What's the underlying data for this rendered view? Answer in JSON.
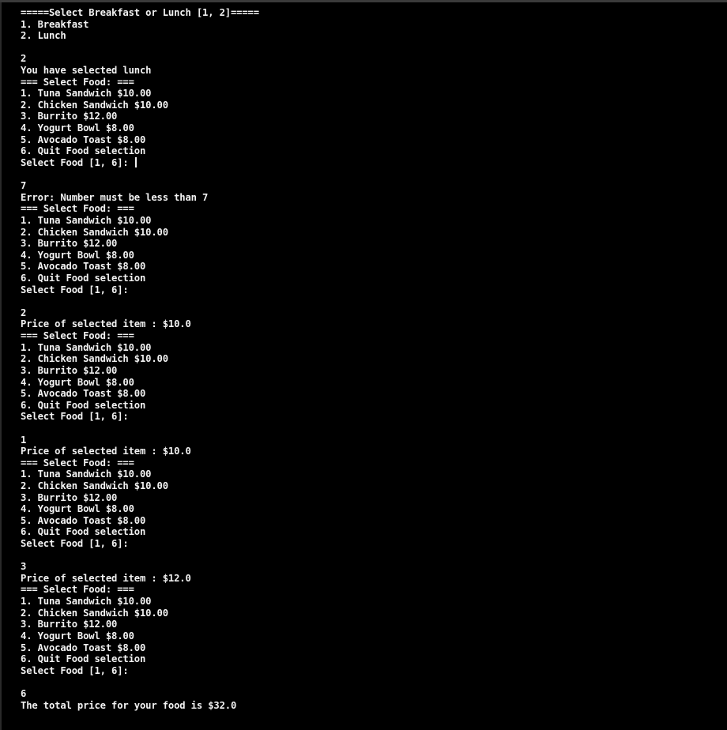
{
  "window": {
    "type": "console",
    "colors": {
      "background": "#000000",
      "text": "#f2f2f2"
    }
  },
  "console": {
    "lines": [
      "=====Select Breakfast or Lunch [1, 2]=====",
      "1. Breakfast",
      "2. Lunch",
      "",
      "2",
      "You have selected lunch",
      "=== Select Food: ===",
      "1. Tuna Sandwich $10.00",
      "2. Chicken Sandwich $10.00",
      "3. Burrito $12.00",
      "4. Yogurt Bowl $8.00",
      "5. Avocado Toast $8.00",
      "6. Quit Food selection",
      "Select Food [1, 6]: ",
      "",
      "7",
      "Error: Number must be less than 7",
      "=== Select Food: ===",
      "1. Tuna Sandwich $10.00",
      "2. Chicken Sandwich $10.00",
      "3. Burrito $12.00",
      "4. Yogurt Bowl $8.00",
      "5. Avocado Toast $8.00",
      "6. Quit Food selection",
      "Select Food [1, 6]:",
      "",
      "2",
      "Price of selected item : $10.0",
      "=== Select Food: ===",
      "1. Tuna Sandwich $10.00",
      "2. Chicken Sandwich $10.00",
      "3. Burrito $12.00",
      "4. Yogurt Bowl $8.00",
      "5. Avocado Toast $8.00",
      "6. Quit Food selection",
      "Select Food [1, 6]:",
      "",
      "1",
      "Price of selected item : $10.0",
      "=== Select Food: ===",
      "1. Tuna Sandwich $10.00",
      "2. Chicken Sandwich $10.00",
      "3. Burrito $12.00",
      "4. Yogurt Bowl $8.00",
      "5. Avocado Toast $8.00",
      "6. Quit Food selection",
      "Select Food [1, 6]:",
      "",
      "3",
      "Price of selected item : $12.0",
      "=== Select Food: ===",
      "1. Tuna Sandwich $10.00",
      "2. Chicken Sandwich $10.00",
      "3. Burrito $12.00",
      "4. Yogurt Bowl $8.00",
      "5. Avocado Toast $8.00",
      "6. Quit Food selection",
      "Select Food [1, 6]:",
      "",
      "6",
      "The total price for your food is $32.0"
    ],
    "cursor_after_line": 13
  }
}
